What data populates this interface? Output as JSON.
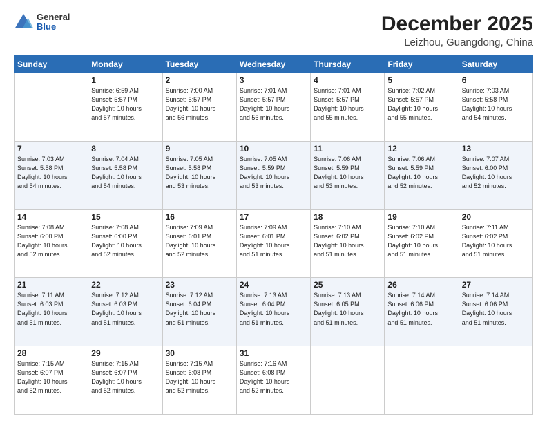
{
  "header": {
    "logo": {
      "general": "General",
      "blue": "Blue"
    },
    "month_year": "December 2025",
    "location": "Leizhou, Guangdong, China"
  },
  "calendar": {
    "days_of_week": [
      "Sunday",
      "Monday",
      "Tuesday",
      "Wednesday",
      "Thursday",
      "Friday",
      "Saturday"
    ],
    "weeks": [
      [
        {
          "day": "",
          "info": ""
        },
        {
          "day": "1",
          "info": "Sunrise: 6:59 AM\nSunset: 5:57 PM\nDaylight: 10 hours\nand 57 minutes."
        },
        {
          "day": "2",
          "info": "Sunrise: 7:00 AM\nSunset: 5:57 PM\nDaylight: 10 hours\nand 56 minutes."
        },
        {
          "day": "3",
          "info": "Sunrise: 7:01 AM\nSunset: 5:57 PM\nDaylight: 10 hours\nand 56 minutes."
        },
        {
          "day": "4",
          "info": "Sunrise: 7:01 AM\nSunset: 5:57 PM\nDaylight: 10 hours\nand 55 minutes."
        },
        {
          "day": "5",
          "info": "Sunrise: 7:02 AM\nSunset: 5:57 PM\nDaylight: 10 hours\nand 55 minutes."
        },
        {
          "day": "6",
          "info": "Sunrise: 7:03 AM\nSunset: 5:58 PM\nDaylight: 10 hours\nand 54 minutes."
        }
      ],
      [
        {
          "day": "7",
          "info": "Sunrise: 7:03 AM\nSunset: 5:58 PM\nDaylight: 10 hours\nand 54 minutes."
        },
        {
          "day": "8",
          "info": "Sunrise: 7:04 AM\nSunset: 5:58 PM\nDaylight: 10 hours\nand 54 minutes."
        },
        {
          "day": "9",
          "info": "Sunrise: 7:05 AM\nSunset: 5:58 PM\nDaylight: 10 hours\nand 53 minutes."
        },
        {
          "day": "10",
          "info": "Sunrise: 7:05 AM\nSunset: 5:59 PM\nDaylight: 10 hours\nand 53 minutes."
        },
        {
          "day": "11",
          "info": "Sunrise: 7:06 AM\nSunset: 5:59 PM\nDaylight: 10 hours\nand 53 minutes."
        },
        {
          "day": "12",
          "info": "Sunrise: 7:06 AM\nSunset: 5:59 PM\nDaylight: 10 hours\nand 52 minutes."
        },
        {
          "day": "13",
          "info": "Sunrise: 7:07 AM\nSunset: 6:00 PM\nDaylight: 10 hours\nand 52 minutes."
        }
      ],
      [
        {
          "day": "14",
          "info": "Sunrise: 7:08 AM\nSunset: 6:00 PM\nDaylight: 10 hours\nand 52 minutes."
        },
        {
          "day": "15",
          "info": "Sunrise: 7:08 AM\nSunset: 6:00 PM\nDaylight: 10 hours\nand 52 minutes."
        },
        {
          "day": "16",
          "info": "Sunrise: 7:09 AM\nSunset: 6:01 PM\nDaylight: 10 hours\nand 52 minutes."
        },
        {
          "day": "17",
          "info": "Sunrise: 7:09 AM\nSunset: 6:01 PM\nDaylight: 10 hours\nand 51 minutes."
        },
        {
          "day": "18",
          "info": "Sunrise: 7:10 AM\nSunset: 6:02 PM\nDaylight: 10 hours\nand 51 minutes."
        },
        {
          "day": "19",
          "info": "Sunrise: 7:10 AM\nSunset: 6:02 PM\nDaylight: 10 hours\nand 51 minutes."
        },
        {
          "day": "20",
          "info": "Sunrise: 7:11 AM\nSunset: 6:02 PM\nDaylight: 10 hours\nand 51 minutes."
        }
      ],
      [
        {
          "day": "21",
          "info": "Sunrise: 7:11 AM\nSunset: 6:03 PM\nDaylight: 10 hours\nand 51 minutes."
        },
        {
          "day": "22",
          "info": "Sunrise: 7:12 AM\nSunset: 6:03 PM\nDaylight: 10 hours\nand 51 minutes."
        },
        {
          "day": "23",
          "info": "Sunrise: 7:12 AM\nSunset: 6:04 PM\nDaylight: 10 hours\nand 51 minutes."
        },
        {
          "day": "24",
          "info": "Sunrise: 7:13 AM\nSunset: 6:04 PM\nDaylight: 10 hours\nand 51 minutes."
        },
        {
          "day": "25",
          "info": "Sunrise: 7:13 AM\nSunset: 6:05 PM\nDaylight: 10 hours\nand 51 minutes."
        },
        {
          "day": "26",
          "info": "Sunrise: 7:14 AM\nSunset: 6:06 PM\nDaylight: 10 hours\nand 51 minutes."
        },
        {
          "day": "27",
          "info": "Sunrise: 7:14 AM\nSunset: 6:06 PM\nDaylight: 10 hours\nand 51 minutes."
        }
      ],
      [
        {
          "day": "28",
          "info": "Sunrise: 7:15 AM\nSunset: 6:07 PM\nDaylight: 10 hours\nand 52 minutes."
        },
        {
          "day": "29",
          "info": "Sunrise: 7:15 AM\nSunset: 6:07 PM\nDaylight: 10 hours\nand 52 minutes."
        },
        {
          "day": "30",
          "info": "Sunrise: 7:15 AM\nSunset: 6:08 PM\nDaylight: 10 hours\nand 52 minutes."
        },
        {
          "day": "31",
          "info": "Sunrise: 7:16 AM\nSunset: 6:08 PM\nDaylight: 10 hours\nand 52 minutes."
        },
        {
          "day": "",
          "info": ""
        },
        {
          "day": "",
          "info": ""
        },
        {
          "day": "",
          "info": ""
        }
      ]
    ]
  }
}
